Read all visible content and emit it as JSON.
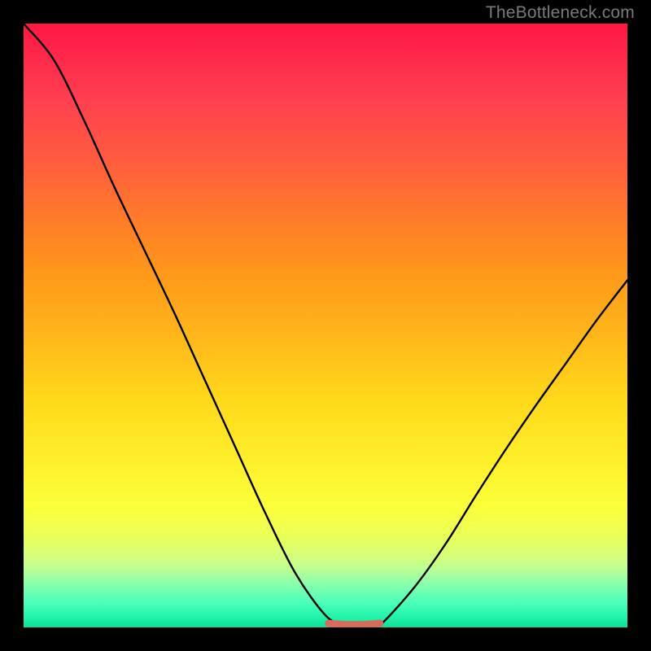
{
  "watermark_text": "TheBottleneck.com",
  "colors": {
    "frame": "#000000",
    "curve": "#000000",
    "bottom_accent": "#d86a5c",
    "gradient_top": "#ff1744",
    "gradient_bottom": "#0ddf98"
  },
  "chart_data": {
    "type": "line",
    "title": "",
    "xlabel": "",
    "ylabel": "",
    "xlim": [
      0,
      100
    ],
    "ylim": [
      0,
      100
    ],
    "series": [
      {
        "name": "bottleneck-curve",
        "x": [
          0,
          5,
          10,
          15,
          20,
          25,
          30,
          35,
          40,
          45,
          50,
          53,
          55,
          58.5,
          60,
          65,
          70,
          75,
          80,
          85,
          90,
          95,
          100
        ],
        "values": [
          100,
          94,
          84,
          73,
          62.5,
          52,
          41,
          30,
          19,
          9,
          2,
          0.5,
          0.4,
          0.5,
          1.3,
          7,
          14,
          22,
          29.7,
          37,
          44,
          51,
          57.5
        ]
      }
    ],
    "annotations": [
      {
        "name": "bottom-accent-segment",
        "x_start": 50.5,
        "x_end": 59,
        "y": 0.6,
        "color": "#d86a5c"
      }
    ]
  }
}
